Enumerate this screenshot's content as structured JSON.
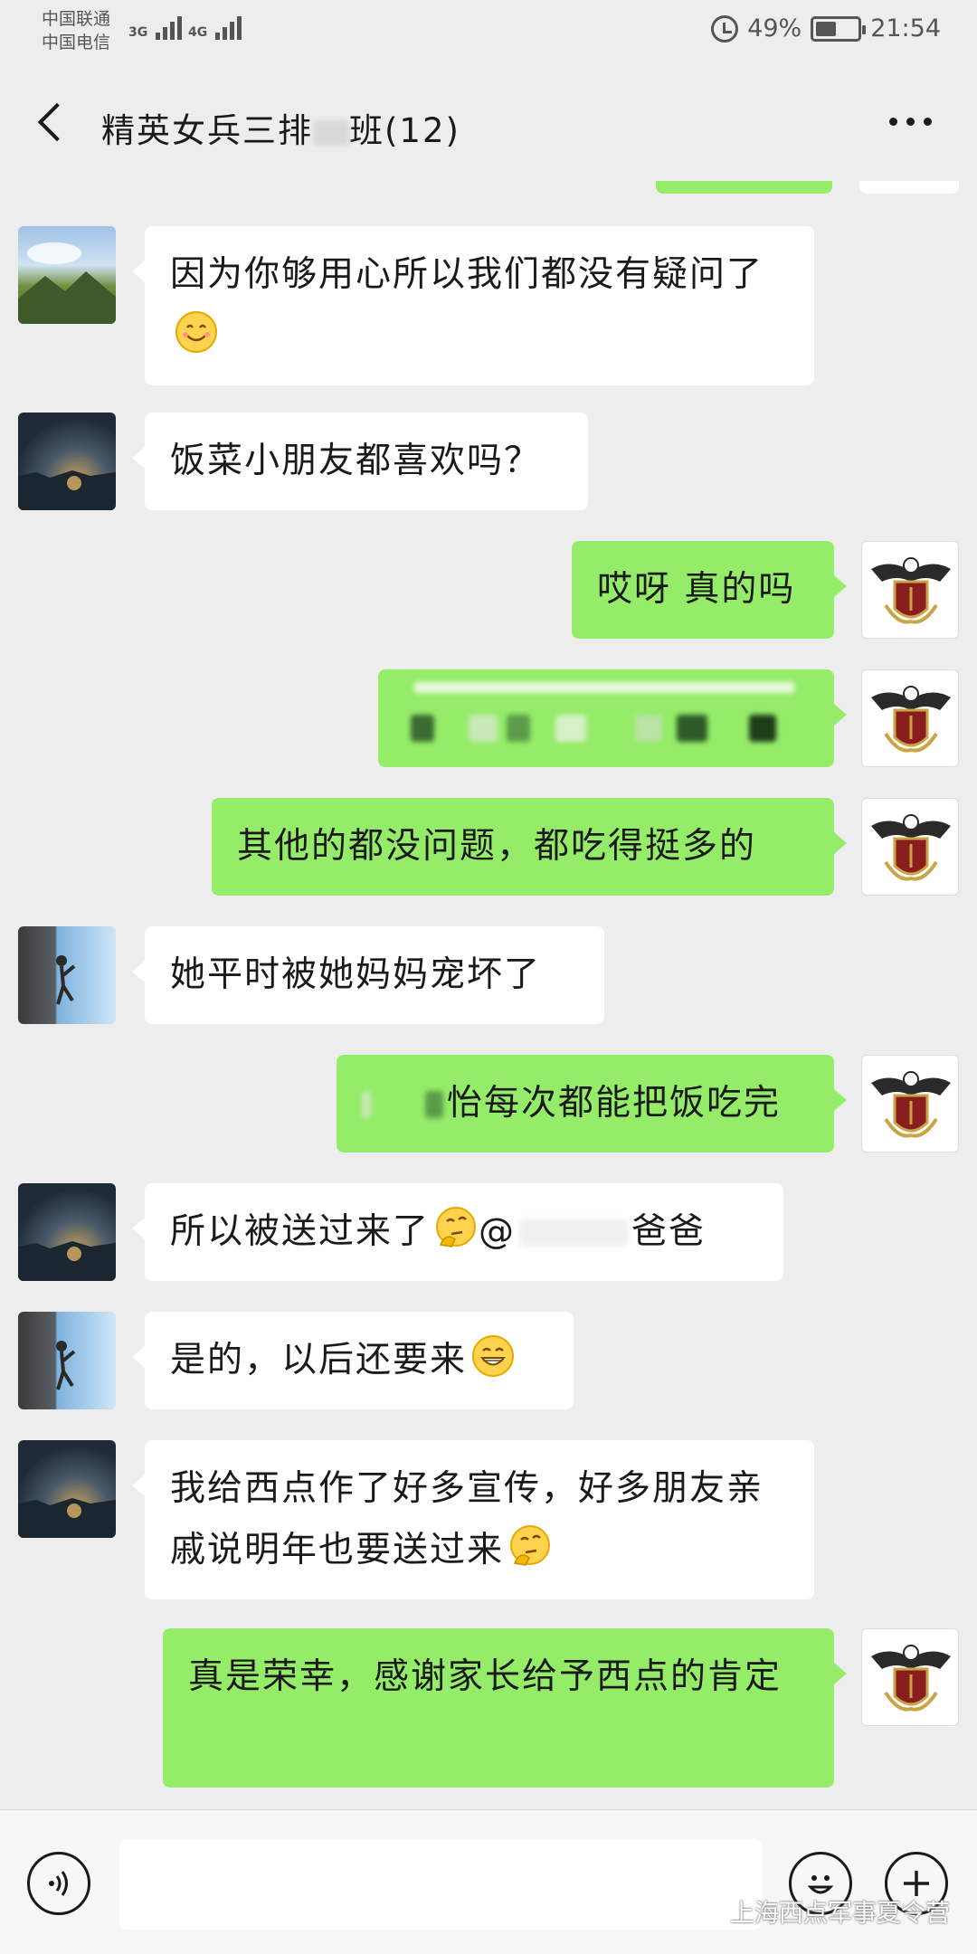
{
  "status_bar": {
    "carrier_1": "中国联通",
    "carrier_2": "中国电信",
    "network_1": "3G",
    "network_2": "4G",
    "battery_percent": "49%",
    "battery_level": 0.49,
    "time": "21:54"
  },
  "nav": {
    "title": "精英女兵三排",
    "title_suffix": "班(12)"
  },
  "messages": [
    {
      "direction": "in",
      "avatar": "landscape-avatar",
      "text": "因为你够用心所以我们都没有疑问了",
      "emoji": "smiling-face"
    },
    {
      "direction": "in",
      "avatar": "city-avatar",
      "text": "饭菜小朋友都喜欢吗？"
    },
    {
      "direction": "out",
      "avatar": "eagle-crest-avatar",
      "text": "哎呀 真的吗"
    },
    {
      "direction": "out",
      "avatar": "eagle-crest-avatar",
      "text": "",
      "redacted": true
    },
    {
      "direction": "out",
      "avatar": "eagle-crest-avatar",
      "text": "其他的都没问题，都吃得挺多的"
    },
    {
      "direction": "in",
      "avatar": "climber-avatar",
      "text": "她平时被她妈妈宠坏了"
    },
    {
      "direction": "out",
      "avatar": "eagle-crest-avatar",
      "text": "怡每次都能把饭吃完"
    },
    {
      "direction": "in",
      "avatar": "city-avatar",
      "text": "所以被送过来了",
      "emoji": "thinking-face",
      "mention_prefix": "@",
      "mention_suffix": "爸爸"
    },
    {
      "direction": "in",
      "avatar": "climber-avatar",
      "text": "是的，以后还要来",
      "emoji": "grinning-face"
    },
    {
      "direction": "in",
      "avatar": "city-avatar",
      "text": "我给西点作了好多宣传，好多朋友亲戚说明年也要送过来",
      "emoji": "thinking-face"
    },
    {
      "direction": "out",
      "avatar": "eagle-crest-avatar",
      "text": "真是荣幸，感谢家长给予西点的肯定"
    }
  ],
  "input_bar": {
    "voice_icon": "voice-icon",
    "emoji_icon": "emoji-icon",
    "plus_icon": "plus-icon",
    "watermark": "上海西点军事夏令营"
  },
  "colors": {
    "background": "#ededed",
    "outgoing_bubble": "#95ec69",
    "incoming_bubble": "#ffffff"
  }
}
